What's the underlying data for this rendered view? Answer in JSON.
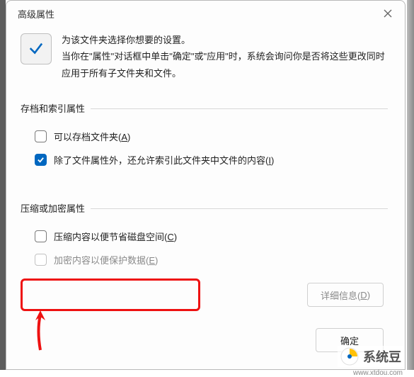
{
  "dialog": {
    "title": "高级属性",
    "intro_line1": "为该文件夹选择你想要的设置。",
    "intro_line2": "当你在\"属性\"对话框中单击\"确定\"或\"应用\"时，系统会询问你是否将这些更改同时应用于所有子文件夹和文件。"
  },
  "group1": {
    "legend": "存档和索引属性",
    "opt1": {
      "label": "可以存档文件夹(",
      "accel": "A",
      "tail": ")",
      "checked": false
    },
    "opt2": {
      "label": "除了文件属性外，还允许索引此文件夹中文件的内容(",
      "accel": "I",
      "tail": ")",
      "checked": true
    }
  },
  "group2": {
    "legend": "压缩或加密属性",
    "opt1": {
      "label": "压缩内容以便节省磁盘空间(",
      "accel": "C",
      "tail": ")",
      "checked": false
    },
    "opt2": {
      "label": "加密内容以便保护数据(",
      "accel": "E",
      "tail": ")",
      "checked": false,
      "disabled": true
    }
  },
  "buttons": {
    "details": "详细信息(",
    "details_accel": "D",
    "details_tail": ")",
    "ok": "确定"
  },
  "watermark": {
    "text": "系统豆",
    "url": "www.xtdou.com"
  },
  "colors": {
    "accent": "#0067c0",
    "highlight": "#e11"
  }
}
